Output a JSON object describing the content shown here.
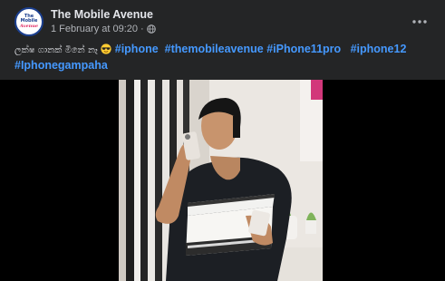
{
  "post": {
    "page_name": "The Mobile Avenue",
    "timestamp": "1 February at 09:20",
    "separator": "·",
    "privacy_icon": "globe-icon",
    "more_icon": "more-horizontal-icon",
    "avatar_logo_lines": [
      "The",
      "Mobile",
      "Avenue"
    ],
    "text_prefix": "ලක්ෂ ගානක් මිනේ නෑ",
    "emoji": "sunglasses-emoji",
    "hashtags": [
      "#iphone",
      "#themobileavenue",
      "#iPhone11pro",
      "#iphone12",
      "#Iphonegampaha"
    ]
  },
  "media": {
    "type": "video",
    "subject": "man-holding-iphones"
  },
  "colors": {
    "background": "#242526",
    "text": "#e4e6eb",
    "secondary_text": "#b0b3b8",
    "hashtag": "#4599ff"
  }
}
